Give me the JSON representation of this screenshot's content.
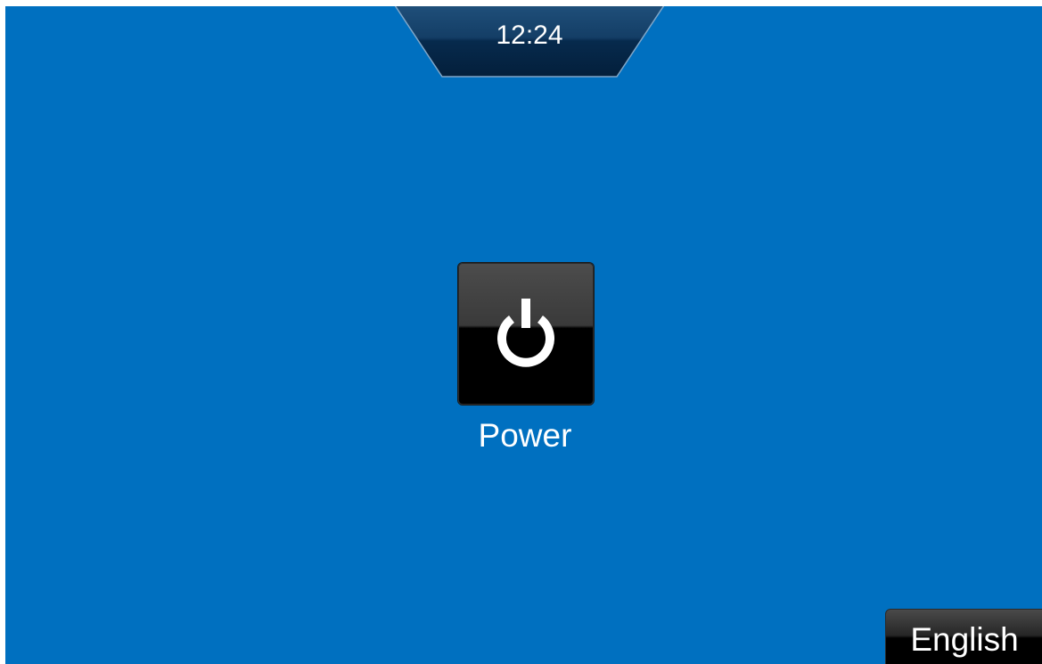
{
  "header": {
    "clock_time": "12:24"
  },
  "main": {
    "power_button": {
      "icon": "power-icon",
      "label": "Power"
    }
  },
  "footer": {
    "language_button_label": "English"
  },
  "colors": {
    "background": "#0070c0",
    "tab_dark": "#0a2f52",
    "button_dark": "#000000",
    "text": "#ffffff"
  }
}
